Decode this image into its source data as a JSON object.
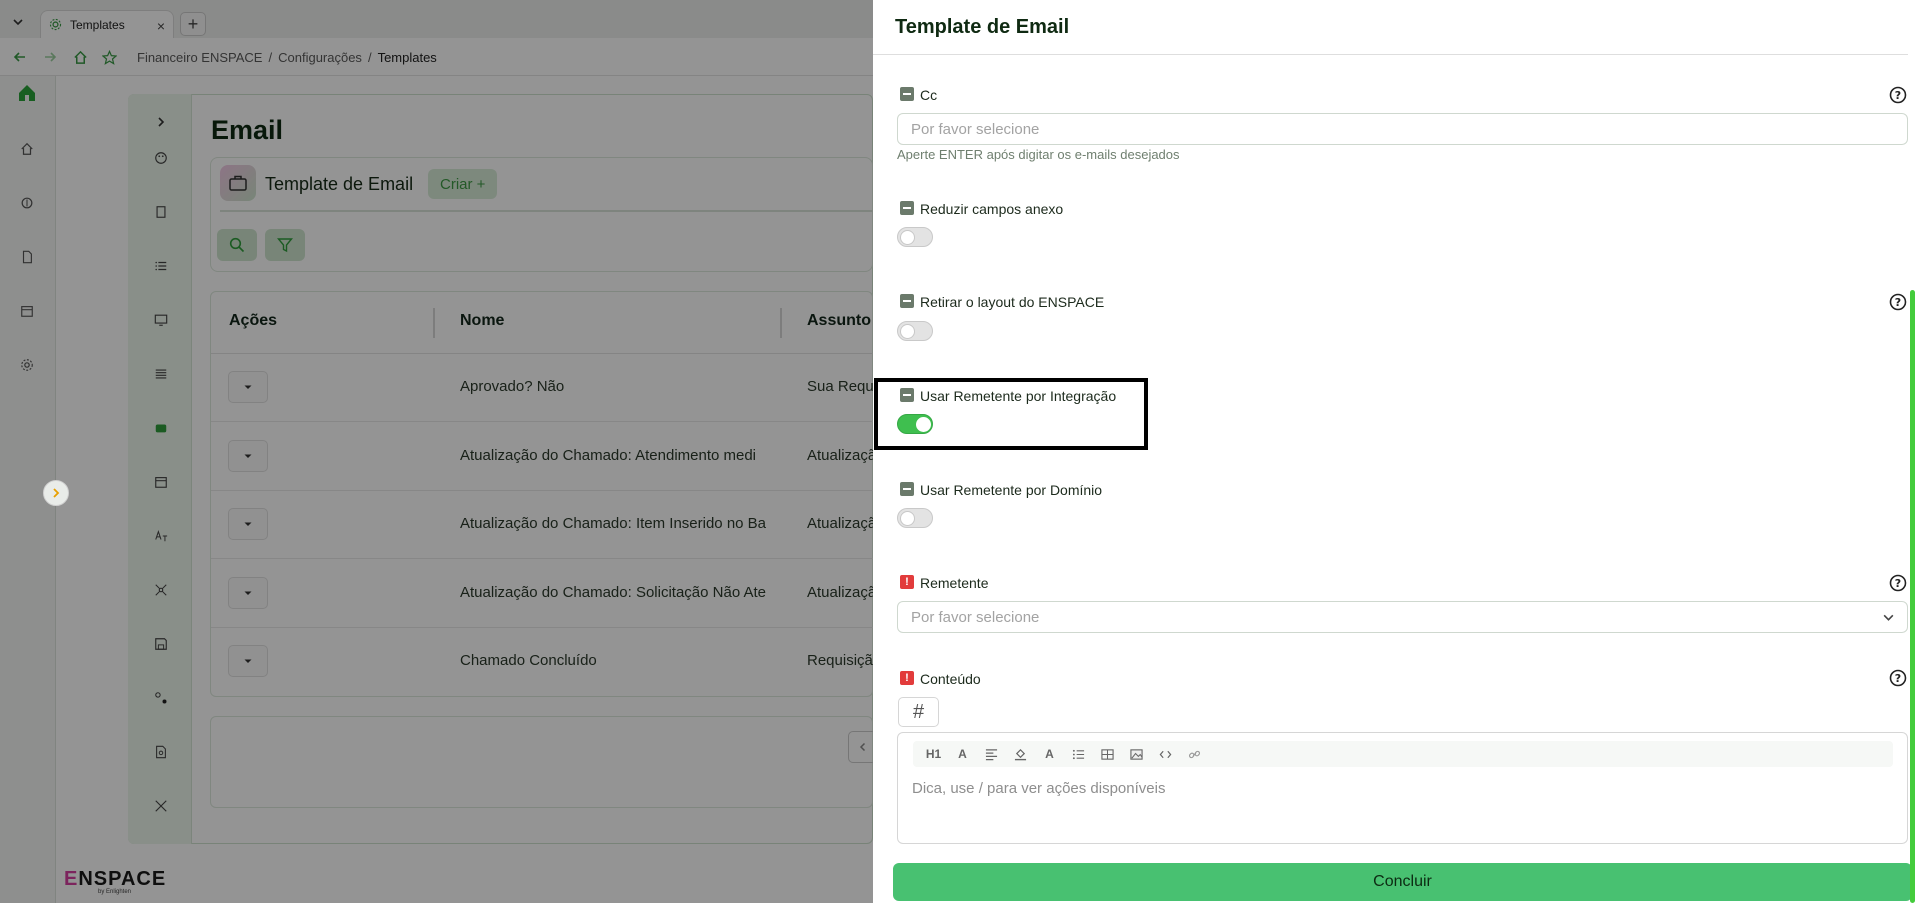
{
  "browser": {
    "tab_title": "Templates",
    "breadcrumb": [
      "Financeiro ENSPACE",
      "Configurações",
      "Templates"
    ]
  },
  "page": {
    "title": "Email",
    "card_title": "Template de Email",
    "create_label": "Criar +"
  },
  "table": {
    "columns": [
      "Ações",
      "Nome",
      "Assunto"
    ],
    "rows": [
      {
        "name": "Aprovado? Não",
        "subject": "Sua Requisição"
      },
      {
        "name": "Atualização do Chamado: Atendimento medi",
        "subject": "Atualização"
      },
      {
        "name": "Atualização do Chamado: Item Inserido no Ba",
        "subject": "Atualização"
      },
      {
        "name": "Atualização do Chamado: Solicitação Não Ate",
        "subject": "Atualização"
      },
      {
        "name": "Chamado Concluído",
        "subject": "Requisição"
      }
    ]
  },
  "footer": {
    "logo_main": "ENSPACE",
    "logo_first_letter": "E",
    "logo_rest": "NSPACE",
    "logo_sub": "by Enlighten"
  },
  "drawer": {
    "title": "Template de Email",
    "cc": {
      "label": "Cc",
      "placeholder": "Por favor selecione",
      "hint": "Aperte ENTER após digitar os e-mails desejados"
    },
    "reduce_attachments": {
      "label": "Reduzir campos anexo",
      "on": false
    },
    "remove_layout": {
      "label": "Retirar o layout do ENSPACE",
      "on": false
    },
    "sender_integration": {
      "label": "Usar Remetente por Integração",
      "on": true
    },
    "sender_domain": {
      "label": "Usar Remetente por Domínio",
      "on": false
    },
    "sender": {
      "label": "Remetente",
      "placeholder": "Por favor selecione"
    },
    "content": {
      "label": "Conteúdo",
      "placeholder": "Dica, use / para ver ações disponíveis",
      "toolbar": [
        "H1",
        "A",
        "align",
        "fill",
        "A",
        "list",
        "table",
        "image",
        "code",
        "link"
      ]
    },
    "submit_label": "Concluir",
    "required_mark": "!"
  },
  "colors": {
    "accent_green": "#48c171",
    "toggle_on": "#3fbf4f",
    "required": "#e23b3b",
    "brand_pink": "#d63fa1"
  }
}
